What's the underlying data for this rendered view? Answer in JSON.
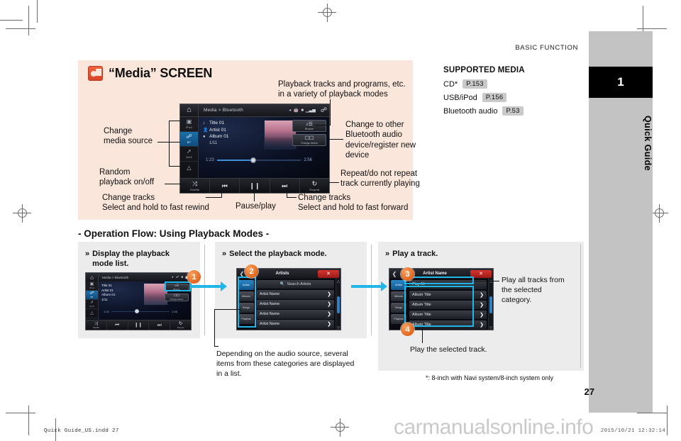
{
  "page": {
    "running_head": "BASIC FUNCTION",
    "chapter_number": "1",
    "chapter_label": "Quick Guide",
    "page_number": "27",
    "footnote": "*: 8-inch with Navi system/8-inch system only"
  },
  "media_panel": {
    "icon": "media-screen-icon",
    "heading": "“Media” SCREEN",
    "callouts": {
      "playback_modes": "Playback tracks and programs, etc.\nin a variety of playback modes",
      "change_media_source": "Change\nmedia source",
      "random_playback": "Random\nplayback on/off",
      "change_tracks_rewind": "Change tracks\nSelect and hold to fast rewind",
      "pause_play": "Pause/play",
      "change_to_other_bt": "Change to other\nBluetooth audio\ndevice/register new\ndevice",
      "repeat": "Repeat/do not repeat\ntrack currently playing",
      "change_tracks_forward": "Change tracks\nSelect and hold to fast forward"
    }
  },
  "head_unit": {
    "home_icon": "home-icon",
    "breadcrumb": "Media > Bluetooth",
    "status_icons": [
      "wifi-icon",
      "bluetooth-icon",
      "battery-icon",
      "signal-icon"
    ],
    "bluetooth_icon": "bluetooth-icon",
    "sources": [
      {
        "label": "iPod",
        "icon": "ipod-icon",
        "active": false
      },
      {
        "label": "BT",
        "icon": "bluetooth-icon",
        "active": true
      },
      {
        "label": "AUX",
        "icon": "aux-icon",
        "active": false
      },
      {
        "label": "",
        "icon": "chevron-up-icon",
        "active": false
      }
    ],
    "metadata": {
      "title": "Title 01",
      "artist": "Artist 01",
      "album": "Album 01",
      "track_count": "1/11"
    },
    "seek": {
      "elapsed": "1:23",
      "total": "2:56",
      "progress_pct": 42
    },
    "right_buttons": [
      {
        "label": "Browse",
        "icon": "browse-icon"
      },
      {
        "label": "Change device",
        "icon": "change-device-icon"
      }
    ],
    "controls": [
      {
        "label": "Shuffle",
        "icon": "shuffle-icon",
        "glyph": "⤨"
      },
      {
        "label": "",
        "icon": "previous-track-icon",
        "glyph": "⏮"
      },
      {
        "label": "",
        "icon": "pause-icon",
        "glyph": "⏸"
      },
      {
        "label": "",
        "icon": "next-track-icon",
        "glyph": "⏭"
      },
      {
        "label": "Repeat",
        "icon": "repeat-icon",
        "glyph": "↻"
      }
    ]
  },
  "supported_media": {
    "title": "SUPPORTED MEDIA",
    "items": [
      {
        "label": "CD*",
        "page_ref": "P.153"
      },
      {
        "label": "USB/iPod",
        "page_ref": "P.156"
      },
      {
        "label": "Bluetooth audio",
        "page_ref": "P.53"
      }
    ]
  },
  "operation_flow": {
    "title": "- Operation Flow: Using Playback Modes -",
    "steps": [
      {
        "number": "1",
        "heading": "Display the playback\nmode list."
      },
      {
        "number": "2",
        "heading": "Select the playback mode."
      },
      {
        "number": "3",
        "heading": "Play a track."
      }
    ],
    "notes": {
      "categories": "Depending on the audio source, several\nitems from these categories are displayed\nin a list.",
      "play_all": "Play all tracks from\nthe selected\ncategory.",
      "play_selected": "Play the selected track."
    }
  },
  "list_screen_2": {
    "back_icon": "chevron-left-icon",
    "title": "Artists",
    "close_label": "✕",
    "search_placeholder": "Search Artists",
    "search_icon": "search-icon",
    "categories": [
      {
        "label": "Artists",
        "active": true
      },
      {
        "label": "Albums",
        "active": false
      },
      {
        "label": "Songs",
        "active": false
      },
      {
        "label": "Playlists",
        "active": false
      }
    ],
    "rows": [
      "Artist Name",
      "Artist Name",
      "Artist Name",
      "Artist Name"
    ]
  },
  "list_screen_3": {
    "back_icon": "chevron-left-icon",
    "title": "Artist Name",
    "close_label": "✕",
    "play_all_label": "Play All",
    "categories": [
      {
        "label": "Artists",
        "active": true
      },
      {
        "label": "Albums",
        "active": false
      },
      {
        "label": "Songs",
        "active": false
      },
      {
        "label": "Playlists",
        "active": false
      }
    ],
    "rows": [
      "Album Title",
      "Album Title",
      "Album Title",
      "Album Title"
    ]
  },
  "thumb_controls": [
    {
      "glyph": "⤨",
      "label": "Shuffle"
    },
    {
      "glyph": "⏮",
      "label": ""
    },
    {
      "glyph": "⏸",
      "label": ""
    },
    {
      "glyph": "⏭",
      "label": ""
    },
    {
      "glyph": "↻",
      "label": "Repeat"
    }
  ],
  "thumb_meta": {
    "breadcrumb": "Media > Bluetooth",
    "title": "Title 01",
    "artist": "Artist 01",
    "album": "Album 01",
    "track_count": "1/11",
    "elapsed": "1:23",
    "total": "2:56",
    "browse_label": "Browse",
    "change_device_label": "Change device"
  },
  "footer": {
    "left": "Quick Guide_US.indd   27",
    "right": "2015/10/21   12:32:14",
    "watermark": "carmanualsonline.info"
  },
  "colors": {
    "panel_bg": "#fae6da",
    "card_bg": "#ececec",
    "accent_cyan": "#21b6e8",
    "bubble_orange": "#e2661f",
    "tab_gray": "#c3c3c3"
  }
}
